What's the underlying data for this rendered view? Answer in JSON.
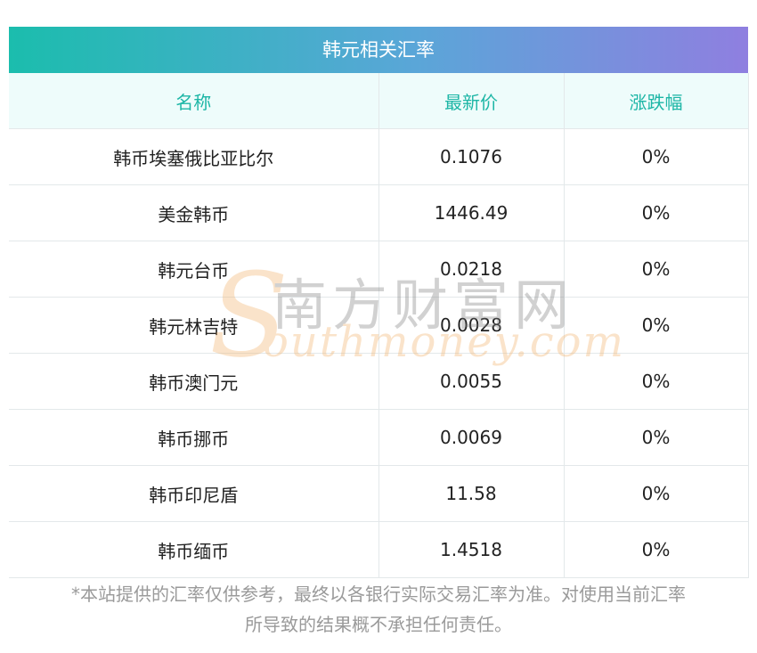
{
  "card": {
    "title": "韩元相关汇率",
    "headers": {
      "name": "名称",
      "price": "最新价",
      "change": "涨跌幅"
    },
    "rows": [
      {
        "name": "韩币埃塞俄比亚比尔",
        "price": "0.1076",
        "change": "0%"
      },
      {
        "name": "美金韩币",
        "price": "1446.49",
        "change": "0%"
      },
      {
        "name": "韩元台币",
        "price": "0.0218",
        "change": "0%"
      },
      {
        "name": "韩元林吉特",
        "price": "0.0028",
        "change": "0%"
      },
      {
        "name": "韩币澳门元",
        "price": "0.0055",
        "change": "0%"
      },
      {
        "name": "韩币挪币",
        "price": "0.0069",
        "change": "0%"
      },
      {
        "name": "韩币印尼盾",
        "price": "11.58",
        "change": "0%"
      },
      {
        "name": "韩币缅币",
        "price": "1.4518",
        "change": "0%"
      }
    ]
  },
  "watermark": {
    "brand_cn": "南方财富网",
    "brand_en": "outhmoney.com",
    "brand_initial": "S"
  },
  "footnote": {
    "line1": "*本站提供的汇率仅供参考，最终以各银行实际交易汇率为准。对使用当前汇率",
    "line2": "所导致的结果概不承担任何责任。"
  },
  "colors": {
    "header_text": "#1db6a6",
    "header_bg": "#eefcfb",
    "gradient_start": "#1bbdad",
    "gradient_end": "#8f7fe0"
  }
}
